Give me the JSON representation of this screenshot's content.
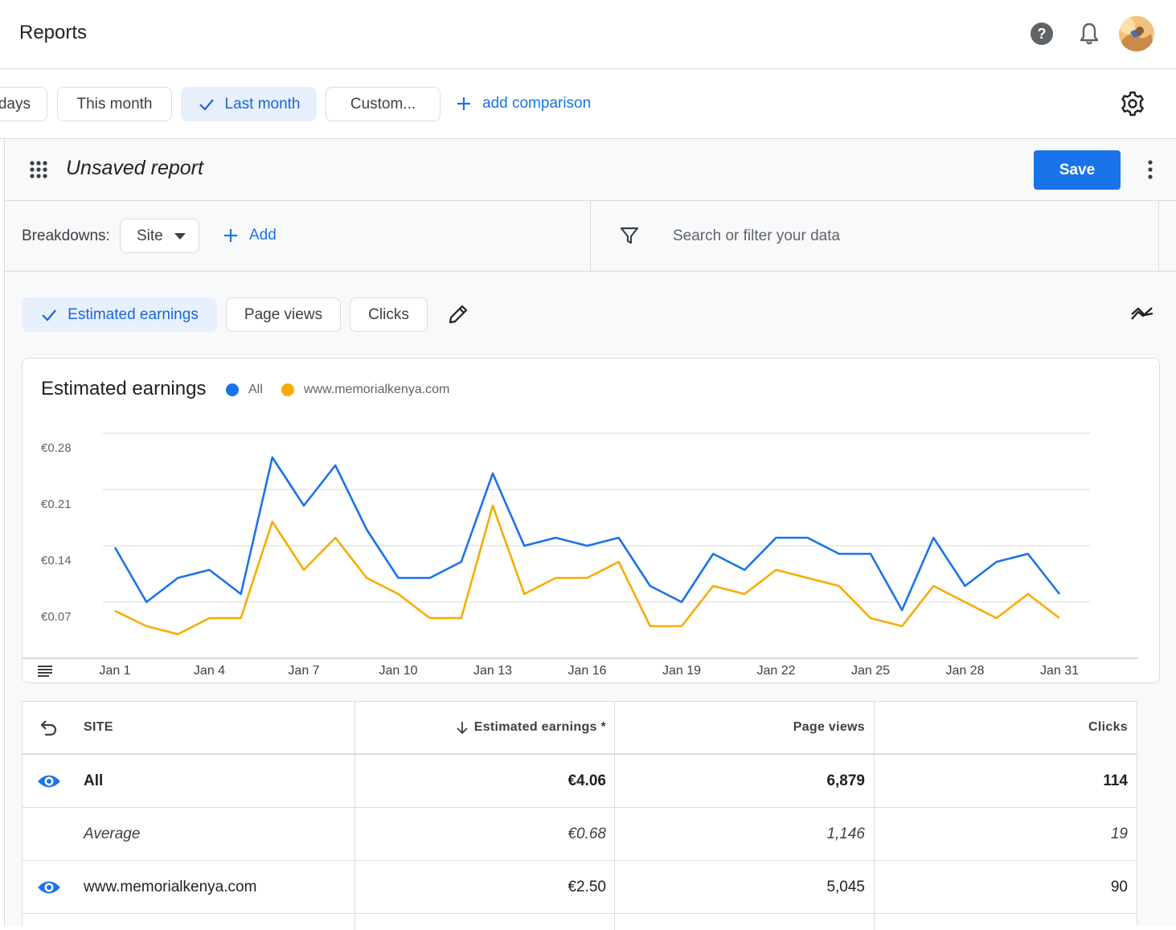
{
  "header": {
    "title": "Reports",
    "help_icon": "help-circle-icon",
    "notifications_icon": "bell-icon",
    "avatar_icon": "account-avatar"
  },
  "date_range": {
    "chips": [
      {
        "label": "days",
        "selected": false
      },
      {
        "label": "This month",
        "selected": false
      },
      {
        "label": "Last month",
        "selected": true
      },
      {
        "label": "Custom..."
      }
    ],
    "add_comparison": "add comparison",
    "settings_icon": "gear-icon"
  },
  "report": {
    "apps_icon": "grid-dots-icon",
    "name": "Unsaved report",
    "save_label": "Save",
    "more_icon": "more-vertical-icon",
    "breakdowns_label": "Breakdowns:",
    "breakdown_value": "Site",
    "add_label": "Add",
    "search_placeholder": "Search or filter your data",
    "filter_icon": "filter-icon"
  },
  "metrics": [
    {
      "label": "Estimated earnings",
      "selected": true
    },
    {
      "label": "Page views",
      "selected": false
    },
    {
      "label": "Clicks",
      "selected": false
    }
  ],
  "colors": {
    "accent": "#1a73e8",
    "series_all": "#1a73e8",
    "series_site": "#f9ab00",
    "selected_chip_bg": "#e8f0fe"
  },
  "chart_data": {
    "type": "line",
    "title": "Estimated earnings",
    "x": [
      "Jan 1",
      "Jan 2",
      "Jan 3",
      "Jan 4",
      "Jan 5",
      "Jan 6",
      "Jan 7",
      "Jan 8",
      "Jan 9",
      "Jan 10",
      "Jan 11",
      "Jan 12",
      "Jan 13",
      "Jan 14",
      "Jan 15",
      "Jan 16",
      "Jan 17",
      "Jan 18",
      "Jan 19",
      "Jan 20",
      "Jan 21",
      "Jan 22",
      "Jan 23",
      "Jan 24",
      "Jan 25",
      "Jan 26",
      "Jan 27",
      "Jan 28",
      "Jan 29",
      "Jan 30",
      "Jan 31"
    ],
    "x_tick_labels": [
      "Jan 1",
      "Jan 4",
      "Jan 7",
      "Jan 10",
      "Jan 13",
      "Jan 16",
      "Jan 19",
      "Jan 22",
      "Jan 25",
      "Jan 28",
      "Jan 31"
    ],
    "y_tick_labels": [
      "€0.28",
      "€0.21",
      "€0.14",
      "€0.07"
    ],
    "y_ticks": [
      0.28,
      0.21,
      0.14,
      0.07
    ],
    "ylim": [
      0.0,
      0.28
    ],
    "grid": true,
    "legend_position": "top-left",
    "series": [
      {
        "name": "All",
        "color": "#1a73e8",
        "values": [
          0.138,
          0.07,
          0.1,
          0.11,
          0.08,
          0.25,
          0.19,
          0.24,
          0.16,
          0.1,
          0.1,
          0.12,
          0.23,
          0.14,
          0.15,
          0.14,
          0.15,
          0.09,
          0.07,
          0.13,
          0.11,
          0.15,
          0.15,
          0.13,
          0.13,
          0.06,
          0.15,
          0.09,
          0.12,
          0.13,
          0.08
        ]
      },
      {
        "name": "www.memorialkenya.com",
        "color": "#f9ab00",
        "values": [
          0.059,
          0.04,
          0.03,
          0.05,
          0.05,
          0.17,
          0.11,
          0.15,
          0.1,
          0.08,
          0.05,
          0.05,
          0.19,
          0.08,
          0.1,
          0.1,
          0.12,
          0.04,
          0.04,
          0.09,
          0.08,
          0.11,
          0.1,
          0.09,
          0.05,
          0.04,
          0.09,
          0.07,
          0.05,
          0.08,
          0.05
        ]
      }
    ]
  },
  "table": {
    "columns": [
      "SITE",
      "Estimated earnings *",
      "Page views",
      "Clicks"
    ],
    "rows": [
      {
        "site": "All",
        "earnings": "€4.06",
        "page_views": "6,879",
        "clicks": "114",
        "style": "bold",
        "visible_icon": true
      },
      {
        "site": "Average",
        "earnings": "€0.68",
        "page_views": "1,146",
        "clicks": "19",
        "style": "italic",
        "visible_icon": false
      },
      {
        "site": "www.memorialkenya.com",
        "earnings": "€2.50",
        "page_views": "5,045",
        "clicks": "90",
        "style": "normal",
        "visible_icon": true
      }
    ]
  }
}
